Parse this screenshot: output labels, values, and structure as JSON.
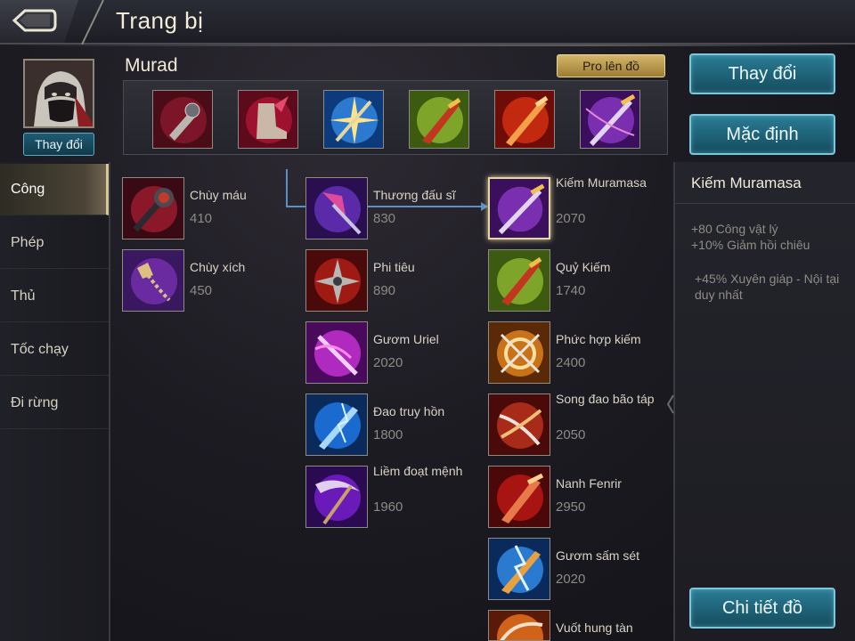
{
  "header": {
    "title": "Trang bị"
  },
  "hero": {
    "change_label": "Thay đổi"
  },
  "build": {
    "name": "Murad",
    "pro_label": "Pro lên đồ",
    "slots": [
      {
        "icon": "spiked-gauntlet-icon"
      },
      {
        "icon": "winged-boots-icon"
      },
      {
        "icon": "starlight-blade-icon"
      },
      {
        "icon": "jade-sword-icon"
      },
      {
        "icon": "fire-sword-icon"
      },
      {
        "icon": "muramasa-sword-icon"
      }
    ]
  },
  "buttons": {
    "change": "Thay đổi",
    "default": "Mặc định",
    "details": "Chi tiết đồ"
  },
  "categories": [
    {
      "label": "Công",
      "active": true
    },
    {
      "label": "Phép",
      "active": false
    },
    {
      "label": "Thủ",
      "active": false
    },
    {
      "label": "Tốc chạy",
      "active": false
    },
    {
      "label": "Đi rừng",
      "active": false
    }
  ],
  "items": {
    "col1": [
      {
        "name": "Chùy máu",
        "price": "410",
        "icon": "blood-mace-icon"
      },
      {
        "name": "Chùy xích",
        "price": "450",
        "icon": "chain-flail-icon"
      }
    ],
    "col2": [
      {
        "name": "Thương đấu sĩ",
        "price": "830",
        "icon": "gladiator-spear-icon"
      },
      {
        "name": "Phi tiêu",
        "price": "890",
        "icon": "shuriken-icon"
      },
      {
        "name": "Gươm Uriel",
        "price": "2020",
        "icon": "uriel-sword-icon"
      },
      {
        "name": "Đao truy hồn",
        "price": "1800",
        "icon": "soul-blade-icon"
      },
      {
        "name": "Liềm đoạt mệnh",
        "price": "1960",
        "icon": "death-scythe-icon"
      }
    ],
    "col3": [
      {
        "name": "Kiếm Muramasa",
        "price": "2070",
        "icon": "muramasa-sword-icon"
      },
      {
        "name": "Quỷ Kiếm",
        "price": "1740",
        "icon": "jade-sword-icon"
      },
      {
        "name": "Phức hợp kiếm",
        "price": "2400",
        "icon": "compound-blade-icon"
      },
      {
        "name": "Song đao bão táp",
        "price": "2050",
        "icon": "storm-blades-icon"
      },
      {
        "name": "Nanh Fenrir",
        "price": "2950",
        "icon": "fenrir-fang-icon"
      },
      {
        "name": "Gươm sấm sét",
        "price": "2020",
        "icon": "thunder-sword-icon"
      },
      {
        "name": "Vuốt hung tàn",
        "price": "",
        "icon": "savage-claw-icon"
      }
    ]
  },
  "detail": {
    "title": "Kiếm Muramasa",
    "stats": [
      "+80 Công vật lý",
      "+10% Giảm hồi chiêu"
    ],
    "passive": "+45% Xuyên giáp - Nội tại duy nhất"
  },
  "colors": {
    "teal": "#2a7c95",
    "gold": "#d4b76a",
    "bg": "#1c1b22"
  }
}
